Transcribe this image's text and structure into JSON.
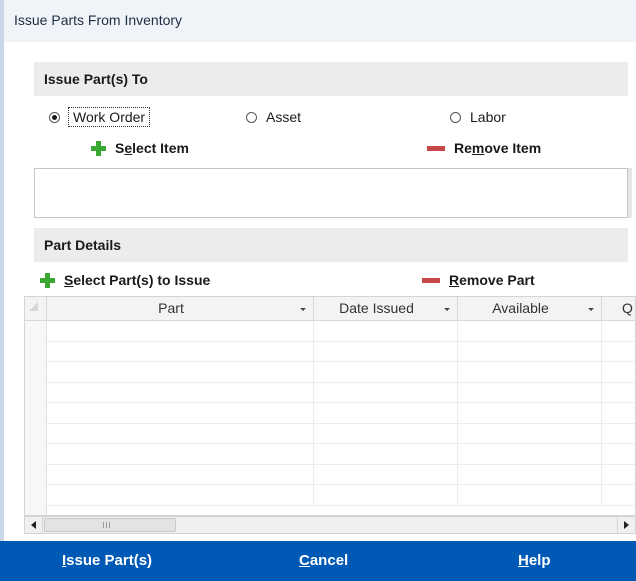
{
  "window": {
    "title": "Issue Parts From Inventory"
  },
  "issue_to": {
    "header": "Issue Part(s) To",
    "options": [
      {
        "label": "Work Order",
        "selected": true
      },
      {
        "label": "Asset",
        "selected": false
      },
      {
        "label": "Labor",
        "selected": false
      }
    ],
    "select_item": {
      "pre": "S",
      "key": "e",
      "post": "lect Item"
    },
    "remove_item": {
      "pre": "Re",
      "key": "m",
      "post": "ove Item"
    },
    "selected_items": []
  },
  "part_details": {
    "header": "Part Details",
    "select_parts": {
      "pre": "",
      "key": "S",
      "post": "elect Part(s) to Issue"
    },
    "remove_part": {
      "pre": "",
      "key": "R",
      "post": "emove Part"
    },
    "columns": [
      "Part",
      "Date Issued",
      "Available",
      "Q"
    ],
    "rows": []
  },
  "footer": {
    "issue": {
      "pre": "",
      "key": "I",
      "post": "ssue Part(s)"
    },
    "cancel": {
      "pre": "",
      "key": "C",
      "post": "ancel"
    },
    "help": {
      "pre": "",
      "key": "H",
      "post": "elp"
    }
  },
  "colors": {
    "footer_bg": "#0059b4",
    "add_icon": "#3aa835",
    "remove_icon": "#c8484a"
  }
}
